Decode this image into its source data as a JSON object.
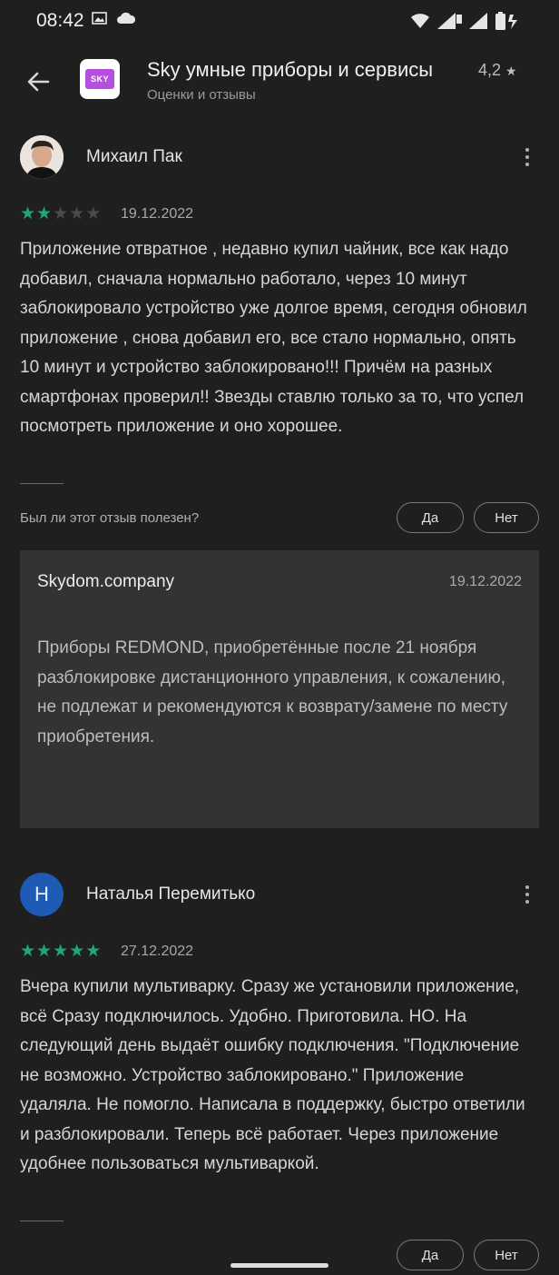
{
  "status_bar": {
    "time": "08:42",
    "left_icons": [
      "gallery-icon",
      "cloud-icon"
    ],
    "right_icons": [
      "wifi-icon",
      "signal-icon",
      "signal-icon",
      "battery-icon"
    ]
  },
  "app": {
    "back_icon": "arrow-back-icon",
    "icon_text": "SKY",
    "title": "Sky умные приборы и сервисы",
    "rating": "4,2",
    "subtitle": "Оценки и отзывы"
  },
  "reviews": [
    {
      "author": "Михаил Пак",
      "stars_filled": 2,
      "stars_total": 5,
      "date": "19.12.2022",
      "text": "Приложение отвратное , недавно купил чайник, все как надо добавил, сначала нормально работало, через 10 минут заблокировало устройство уже долгое время, сегодня обновил приложение , снова добавил его, все стало нормально, опять 10 минут и устройство заблокировано!!! Причём на разных смартфонах проверил!! Звезды ставлю только за то, что успел посмотреть приложение и оно хорошее.",
      "helpful_question": "Был ли этот отзыв полезен?",
      "yes_label": "Да",
      "no_label": "Нет",
      "reply": {
        "author": "Skydom.company",
        "date": "19.12.2022",
        "text": "Приборы REDMOND, приобретённые после 21 ноября разблокировке дистанционного управления, к сожалению, не подлежат и рекомендуются к возврату/замене по месту приобретения."
      }
    },
    {
      "author": "Наталья Перемитько",
      "avatar_letter": "Н",
      "stars_filled": 5,
      "stars_total": 5,
      "date": "27.12.2022",
      "text": "Вчера купили мультиварку. Сразу же установили приложение, всё Сразу подключилось. Удобно. Приготовила. НО. На следующий день выдаёт ошибку подключения. \"Подключение не возможно. Устройство заблокировано.\" Приложение удаляла. Не помогло. Написала в поддержку, быстро ответили и разблокировали. Теперь всё работает. Через приложение удобнее пользоваться мультиваркой.",
      "yes_label": "Да",
      "no_label": "Нет"
    }
  ],
  "colors": {
    "background": "#1f1f1f",
    "star_filled": "#1fa67a",
    "star_empty": "#4a4a4a",
    "reply_background": "#333333",
    "avatar_blue": "#1e5bb5",
    "app_icon_purple": "#b44fe0"
  }
}
